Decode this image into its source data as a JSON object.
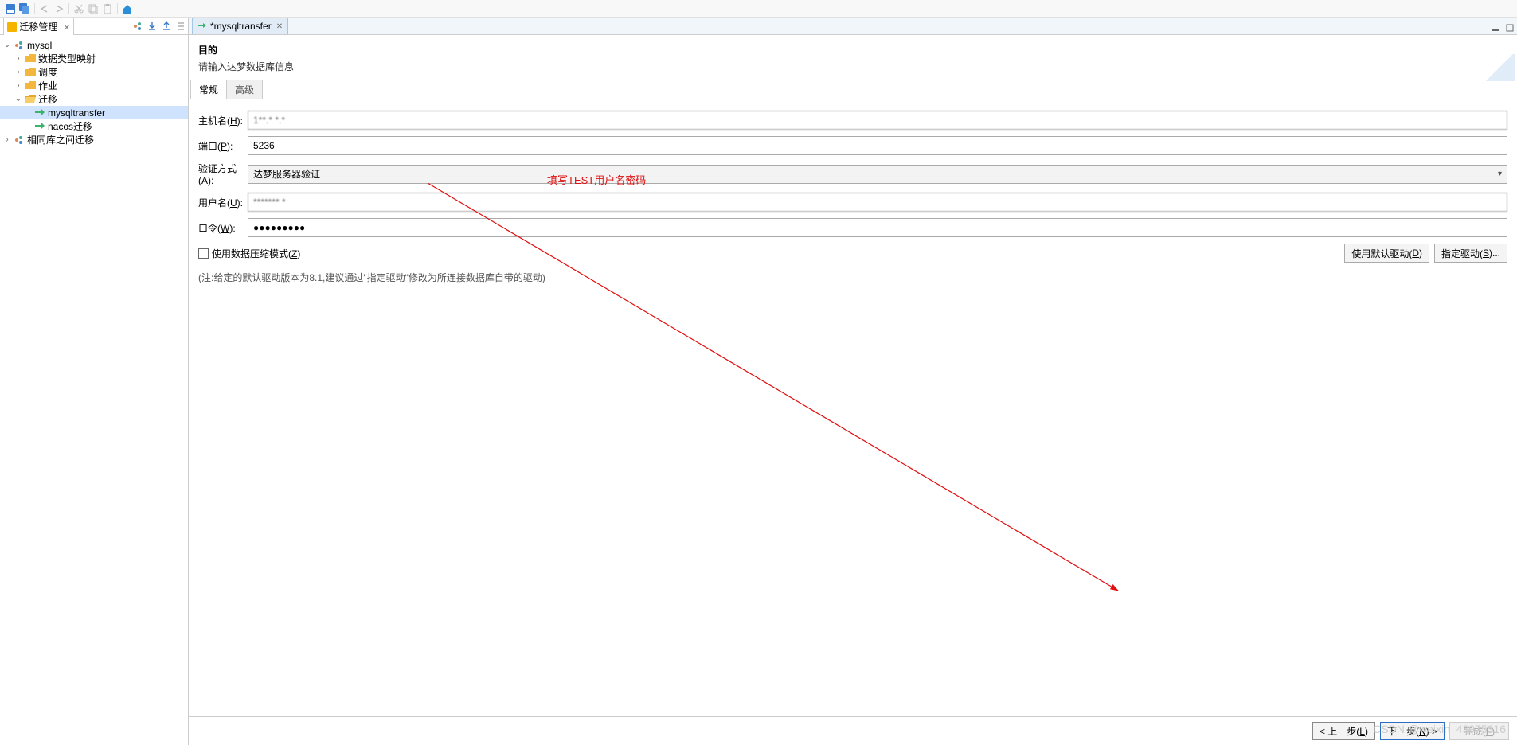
{
  "toolbar": {
    "icons": [
      "save-icon",
      "save-all-icon",
      "cut-icon",
      "copy-icon",
      "paste-icon",
      "search-icon",
      "copy2-icon",
      "paste2-icon",
      "home-icon"
    ]
  },
  "left_panel": {
    "tab_title": "迁移管理",
    "tree": {
      "root": {
        "label": "mysql"
      },
      "items": [
        {
          "label": "数据类型映射",
          "icon": "folder"
        },
        {
          "label": "调度",
          "icon": "folder"
        },
        {
          "label": "作业",
          "icon": "folder"
        },
        {
          "label": "迁移",
          "icon": "folder-open",
          "expanded": true,
          "children": [
            {
              "label": "mysqltransfer",
              "icon": "transfer",
              "selected": true
            },
            {
              "label": "nacos迁移",
              "icon": "transfer"
            }
          ]
        }
      ],
      "root2": {
        "label": "相同库之间迁移"
      }
    }
  },
  "editor": {
    "tab_title": "*mysqltransfer"
  },
  "form": {
    "title": "目的",
    "subtitle": "请输入达梦数据库信息",
    "tabs": {
      "general": "常规",
      "advanced": "高级"
    },
    "fields": {
      "host_label": "主机名(H):",
      "host_value": "1**.* *.*",
      "port_label": "端口(P):",
      "port_value": "5236",
      "auth_label": "验证方式(A):",
      "auth_value": "达梦服务器验证",
      "user_label": "用户名(U):",
      "user_value": "******* *",
      "pw_label": "口令(W):",
      "pw_value": "●●●●●●●●●"
    },
    "checkbox": "使用数据压缩模式(Z)",
    "btn_default_driver": "使用默认驱动(D)",
    "btn_select_driver": "指定驱动(S)...",
    "note": "(注:给定的默认驱动版本为8.1,建议通过\"指定驱动\"修改为所连接数据库自带的驱动)"
  },
  "annotation": "填写TEST用户名密码",
  "wizard": {
    "back": "< 上一步(L)",
    "next": "下一步(N) >",
    "finish": "完成(F)"
  },
  "watermark": "CSDN @weixin_43975316"
}
